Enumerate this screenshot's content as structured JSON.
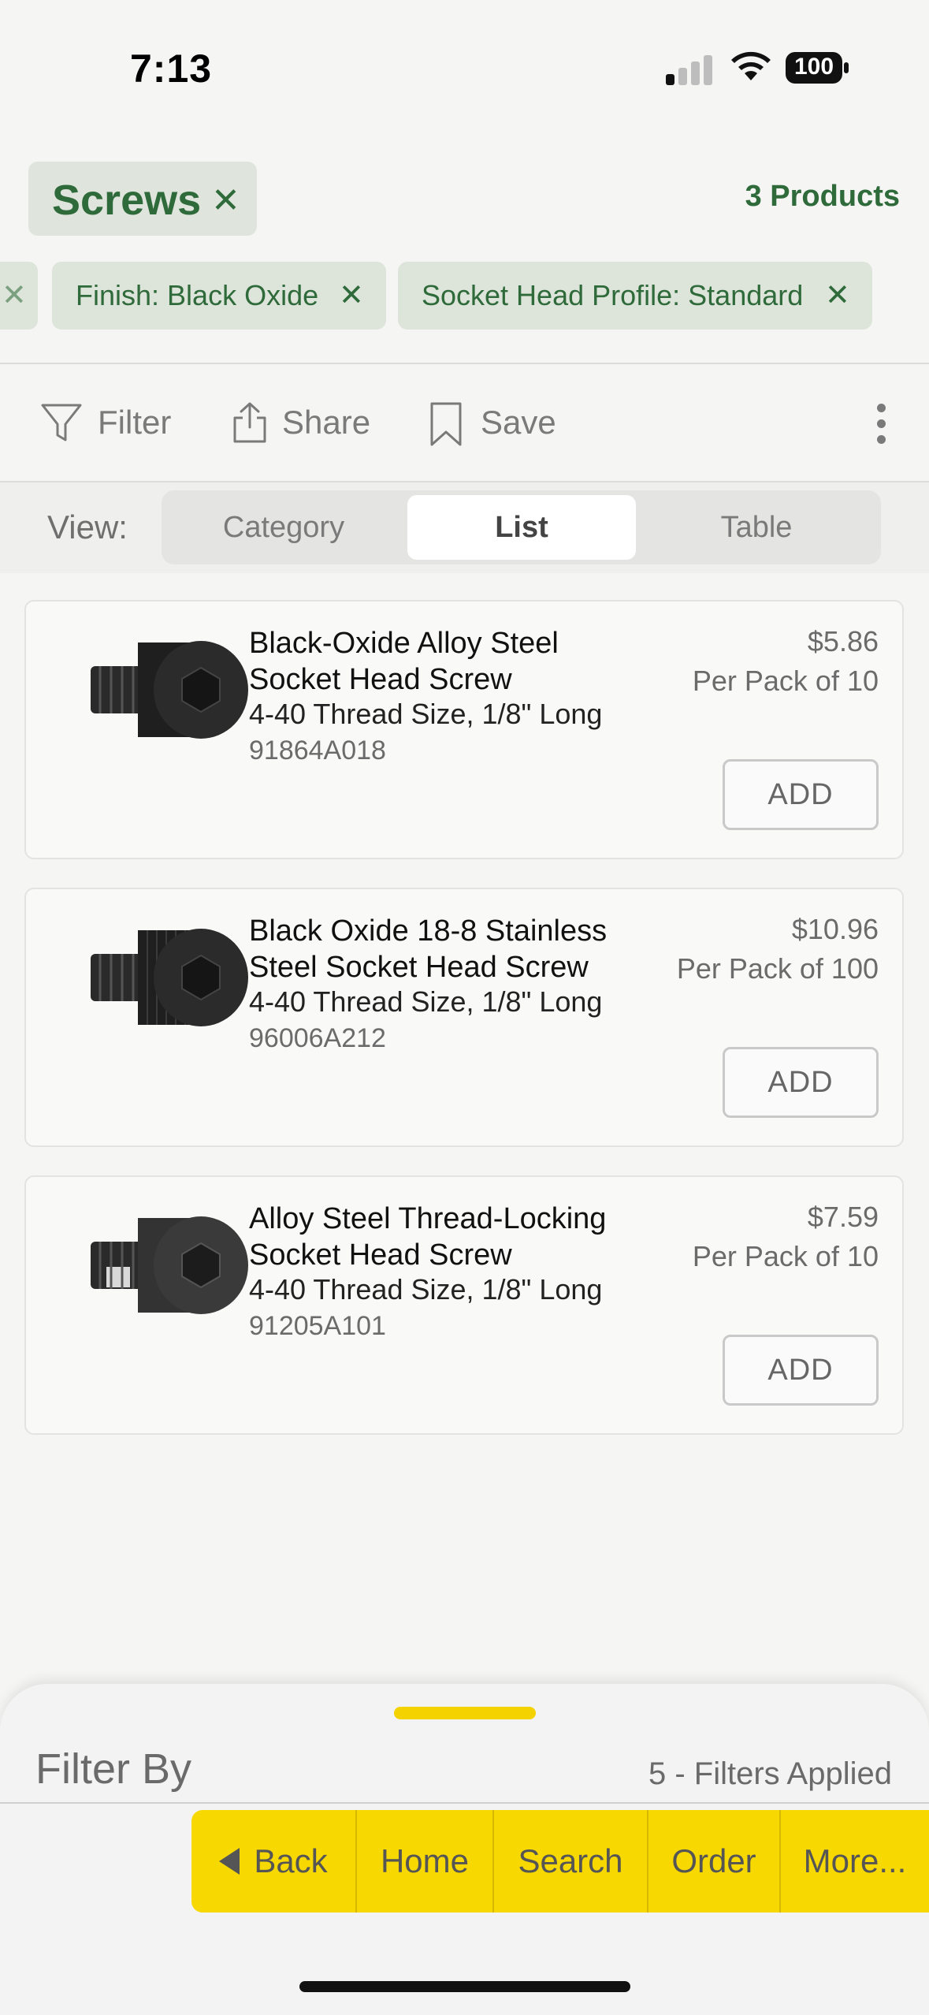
{
  "status_bar": {
    "time": "7:13",
    "battery": "100"
  },
  "header": {
    "category_chip": "Screws",
    "products_count": "3 Products",
    "filters": [
      {
        "label": "Finish: Black Oxide"
      },
      {
        "label": "Socket Head Profile: Standard"
      }
    ]
  },
  "toolbar": {
    "filter_label": "Filter",
    "share_label": "Share",
    "save_label": "Save"
  },
  "view": {
    "label": "View:",
    "options": [
      "Category",
      "List",
      "Table"
    ],
    "selected": "List"
  },
  "products": [
    {
      "title_line1": "Black-Oxide Alloy Steel",
      "title_line2": "Socket Head Screw",
      "spec": "4-40 Thread Size, 1/8\" Long",
      "part_number": "91864A018",
      "price": "$5.86",
      "pack": "Per Pack of 10",
      "add_label": "ADD"
    },
    {
      "title_line1": "Black Oxide 18-8 Stainless",
      "title_line2": "Steel Socket Head Screw",
      "spec": "4-40 Thread Size, 1/8\" Long",
      "part_number": "96006A212",
      "price": "$10.96",
      "pack": "Per Pack of 100",
      "add_label": "ADD"
    },
    {
      "title_line1": "Alloy Steel Thread-Locking",
      "title_line2": "Socket Head Screw",
      "spec": "4-40 Thread Size, 1/8\" Long",
      "part_number": "91205A101",
      "price": "$7.59",
      "pack": "Per Pack of 10",
      "add_label": "ADD"
    }
  ],
  "filter_sheet": {
    "title": "Filter By",
    "applied": "5 - Filters Applied"
  },
  "bottom_nav": {
    "back": "Back",
    "home": "Home",
    "search": "Search",
    "order": "Order",
    "more": "More..."
  },
  "colors": {
    "accent_green": "#2f6a3a",
    "nav_yellow": "#f7d800"
  }
}
